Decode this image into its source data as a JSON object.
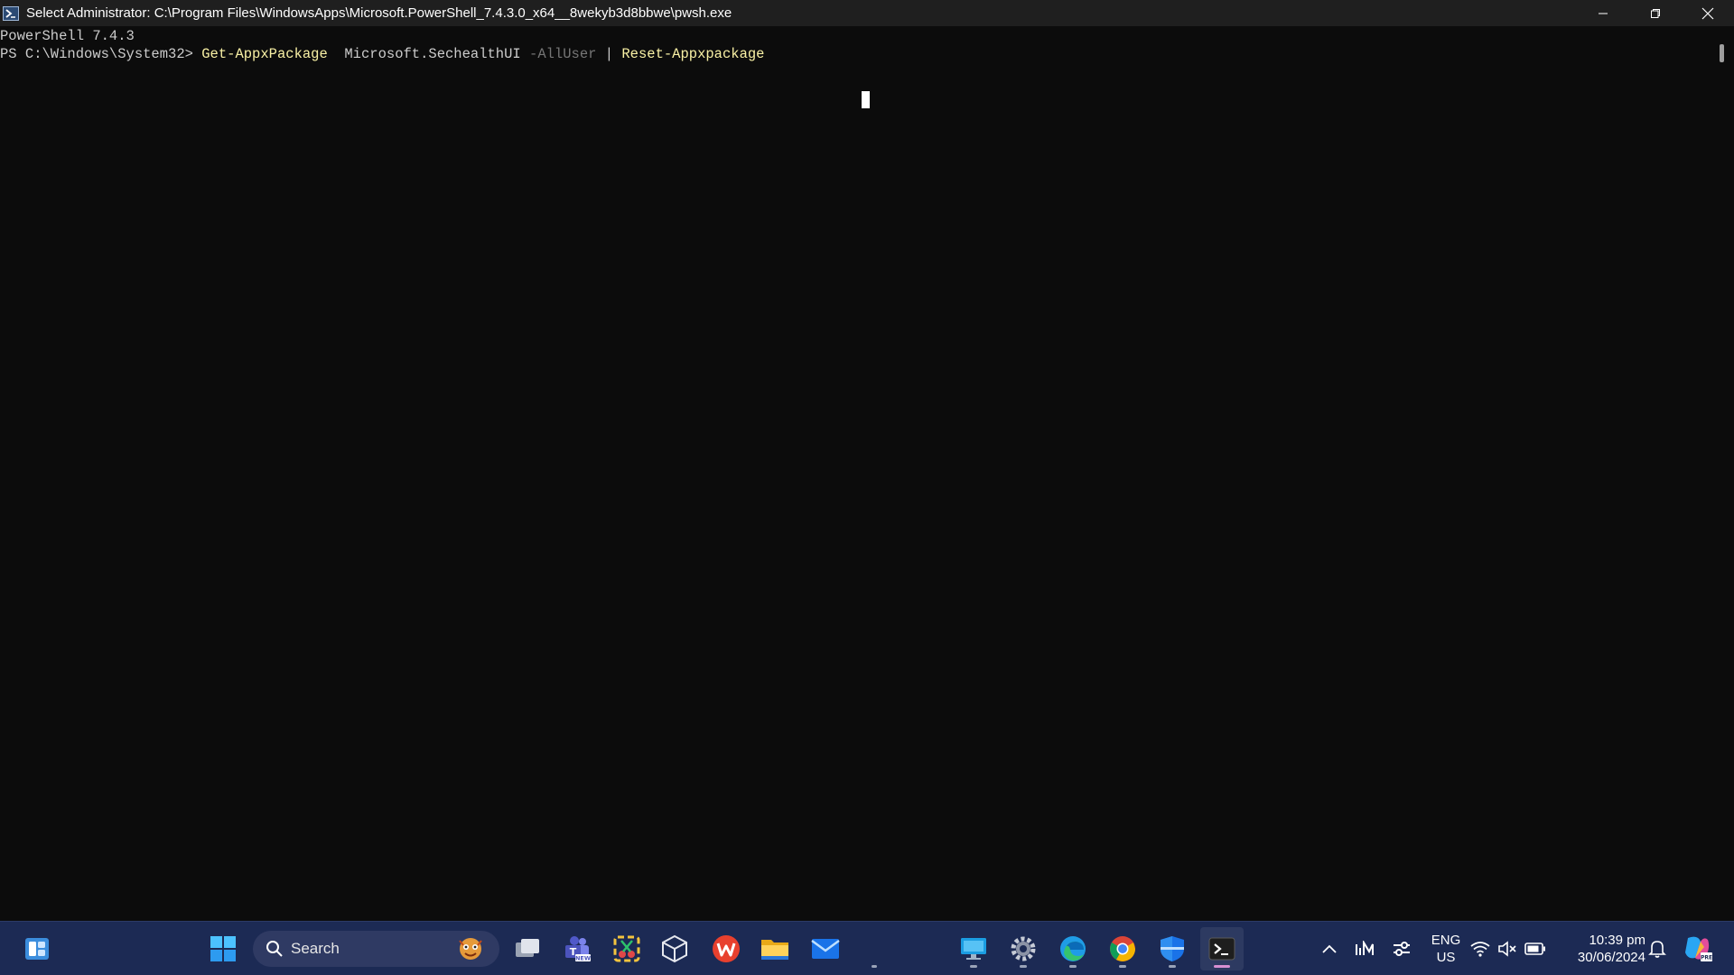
{
  "window": {
    "title": "Select Administrator: C:\\Program Files\\WindowsApps\\Microsoft.PowerShell_7.4.3.0_x64__8wekyb3d8bbwe\\pwsh.exe",
    "icon": "powershell-icon",
    "controls": [
      "minimize-icon",
      "restore-icon",
      "close-icon"
    ]
  },
  "terminal": {
    "banner": "PowerShell 7.4.3",
    "prompt": "PS C:\\Windows\\System32> ",
    "cmd1": "Get-AppxPackage",
    "arg1": "  Microsoft.SechealthUI ",
    "param1": "-AllUser",
    "pipe": " | ",
    "cmd2": "Reset-Appxpackage",
    "colors": {
      "background": "#0c0c0c",
      "text": "#cccccc",
      "command": "#f9f1a5",
      "parameter": "#767676"
    }
  },
  "taskbar": {
    "search_label": "Search",
    "apps": [
      "widgets-icon",
      "start-icon",
      "task-view-icon",
      "teams-icon",
      "snipping-tool-icon",
      "3d-viewer-icon",
      "wps-office-icon",
      "file-explorer-icon",
      "mail-icon",
      "remote-desktop-icon",
      "settings-icon",
      "edge-icon",
      "chrome-icon",
      "defender-icon",
      "terminal-icon"
    ],
    "tray": {
      "language_line1": "ENG",
      "language_line2": "US",
      "time": "10:39 pm",
      "date": "30/06/2024"
    },
    "colors": {
      "background": "#1c2a54",
      "accent": "#d78fd2"
    }
  }
}
